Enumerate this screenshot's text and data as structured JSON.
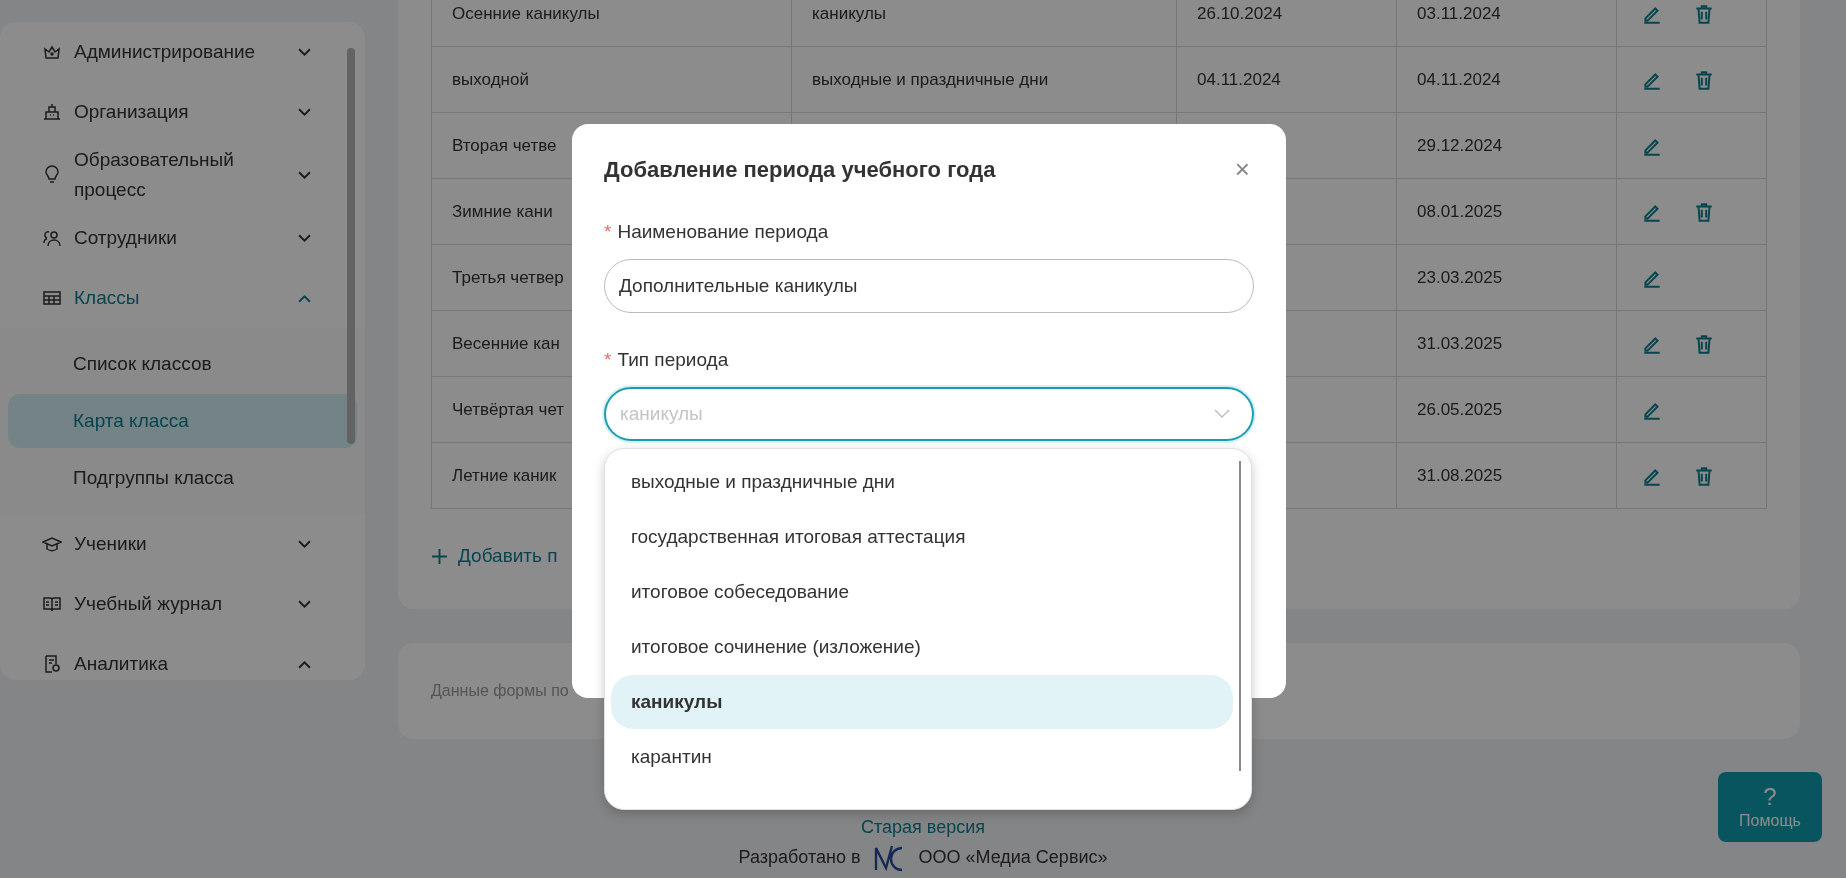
{
  "sidebar": {
    "items": [
      {
        "label": "Администрирование",
        "expanded": false,
        "selected": false
      },
      {
        "label": "Организация",
        "expanded": false,
        "selected": false
      },
      {
        "label": "Образовательный процесс",
        "expanded": false,
        "selected": false
      },
      {
        "label": "Сотрудники",
        "expanded": false,
        "selected": false
      },
      {
        "label": "Классы",
        "expanded": true,
        "selected": true,
        "children": [
          {
            "label": "Список классов",
            "selected": false
          },
          {
            "label": "Карта класса",
            "selected": true
          },
          {
            "label": "Подгруппы класса",
            "selected": false
          }
        ]
      },
      {
        "label": "Ученики",
        "expanded": false,
        "selected": false
      },
      {
        "label": "Учебный журнал",
        "expanded": false,
        "selected": false
      },
      {
        "label": "Аналитика",
        "expanded": true,
        "selected": false
      }
    ]
  },
  "table": {
    "rows": [
      {
        "name": "Осенние каникулы",
        "type": "каникулы",
        "start": "26.10.2024",
        "end": "03.11.2024",
        "deletable": true
      },
      {
        "name": "выходной",
        "type": "выходные и праздничные дни",
        "start": "04.11.2024",
        "end": "04.11.2024",
        "deletable": true
      },
      {
        "name": "Вторая четве",
        "end": "29.12.2024",
        "deletable": false
      },
      {
        "name": "Зимние кани",
        "end": "08.01.2025",
        "deletable": true
      },
      {
        "name": "Третья четвер",
        "end": "23.03.2025",
        "deletable": false
      },
      {
        "name": "Весенние кан",
        "end": "31.03.2025",
        "deletable": true
      },
      {
        "name": "Четвёртая чет",
        "end": "26.05.2025",
        "deletable": false
      },
      {
        "name": "Летние каник",
        "end": "31.08.2025",
        "deletable": true
      }
    ]
  },
  "add_link": "Добавить п",
  "info_card": {
    "text": "Данные формы по"
  },
  "footer": {
    "old_version": "Старая версия",
    "developed_by": "Разработано в",
    "company": "ООО «Медиа Сервис»"
  },
  "help_button": {
    "icon_text": "?",
    "label": "Помощь"
  },
  "modal": {
    "title": "Добавление периода учебного года",
    "close": "×",
    "required_mark": "*",
    "fields": [
      {
        "label": "Наименование периода",
        "required": true,
        "value": "Дополнительные каникулы",
        "focused": false
      },
      {
        "label": "Тип периода",
        "required": true,
        "placeholder": "каникулы",
        "focused": true
      }
    ],
    "dropdown": {
      "options": [
        {
          "label": "выходные и праздничные дни",
          "selected": false
        },
        {
          "label": "государственная итоговая аттестация",
          "selected": false
        },
        {
          "label": "итоговое собеседование",
          "selected": false
        },
        {
          "label": "итоговое сочинение (изложение)",
          "selected": false
        },
        {
          "label": "каникулы",
          "selected": true
        },
        {
          "label": "карантин",
          "selected": false
        }
      ]
    }
  }
}
